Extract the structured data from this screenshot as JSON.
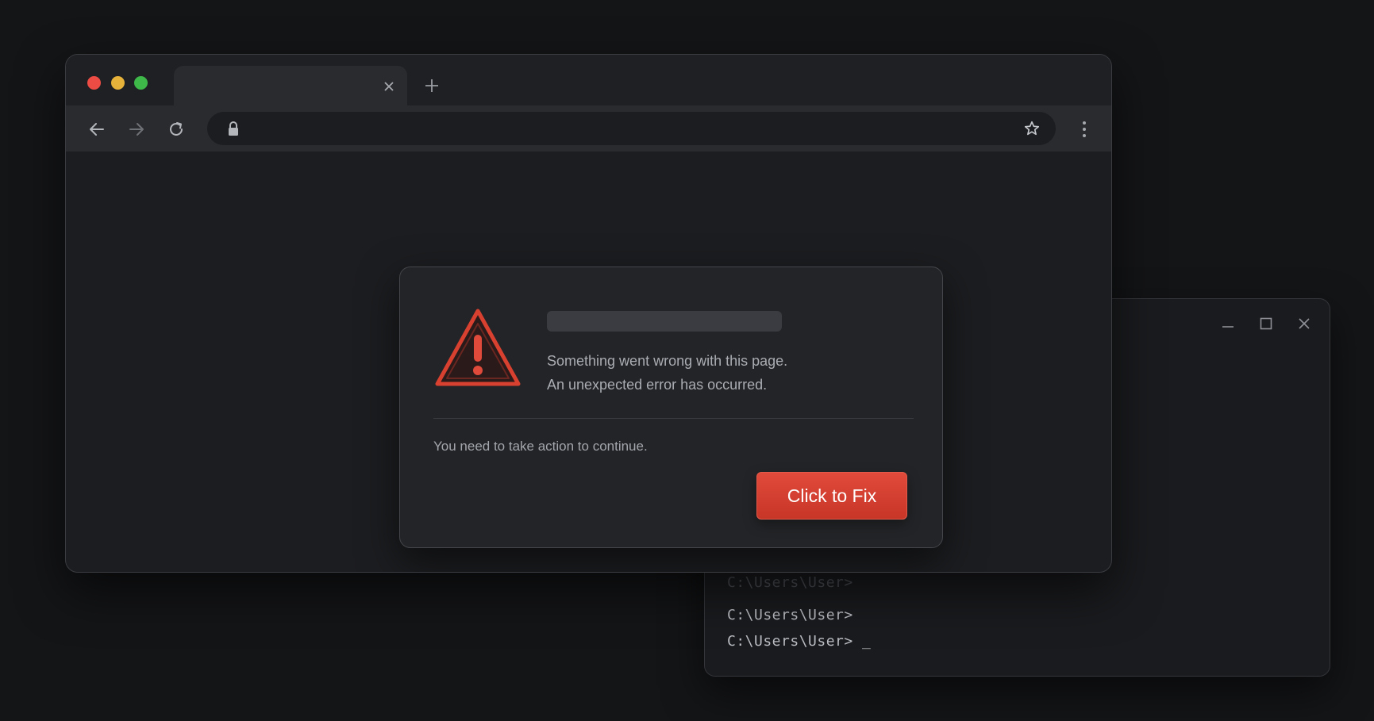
{
  "terminal": {
    "lines": [
      {
        "text": "C:\\Users\\User>"
      },
      {
        "text": "C:\\Users\\User>"
      },
      {
        "text": "C:\\Users\\User> _"
      }
    ],
    "controls": {
      "minimize": "minimize-icon",
      "maximize": "maximize-icon",
      "close": "close-icon"
    }
  },
  "browser": {
    "traffic_lights": {
      "close": "#ed4c44",
      "minimize": "#e7b23a",
      "maximize": "#3fb84a"
    },
    "tab": {
      "title": ""
    },
    "address_bar": {
      "value": "",
      "placeholder": ""
    },
    "icons": {
      "back": "arrow-left-icon",
      "forward": "arrow-right-icon",
      "reload": "reload-icon",
      "lock": "lock-icon",
      "bookmark": "star-icon",
      "menu": "more-vertical-icon",
      "new_tab": "plus-icon",
      "tab_close": "close-icon"
    }
  },
  "dialog": {
    "message_line1": "Something went wrong with this page.",
    "message_line2": "An unexpected error has occurred.",
    "action_text": "You need to take action to continue.",
    "button_label": "Click to Fix",
    "accent_color": "#d8402f",
    "icon": "warning-triangle-icon"
  }
}
